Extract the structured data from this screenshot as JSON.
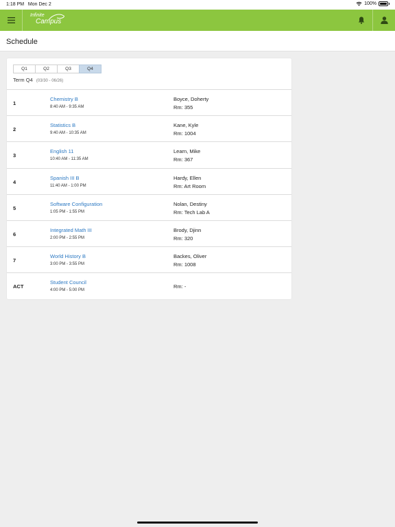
{
  "status_bar": {
    "time": "1:18 PM",
    "date": "Mon Dec 2",
    "battery": "100%",
    "icons": [
      "wifi-icon",
      "battery-icon"
    ]
  },
  "header": {
    "logo_top": "Infinite",
    "logo_bottom": "Campus",
    "brand_color": "#8cc63f",
    "icons": [
      "hamburger-menu-icon",
      "bell-icon",
      "user-icon"
    ]
  },
  "page": {
    "title": "Schedule"
  },
  "schedule": {
    "tabs": [
      "Q1",
      "Q2",
      "Q3",
      "Q4"
    ],
    "active_tab": "Q4",
    "term_label": "Term Q4",
    "term_dates": "(03/30 - 06/26)",
    "rows": [
      {
        "period": "1",
        "course": "Chemistry B",
        "time": "8:40 AM - 9:35 AM",
        "teacher": "Boyce, Doherty",
        "room": "Rm: 355"
      },
      {
        "period": "2",
        "course": "Statistics B",
        "time": "9:40 AM - 10:35 AM",
        "teacher": "Kane, Kyle",
        "room": "Rm: 1004"
      },
      {
        "period": "3",
        "course": "English 11",
        "time": "10:40 AM - 11:35 AM",
        "teacher": "Learn, Mike",
        "room": "Rm: 367"
      },
      {
        "period": "4",
        "course": "Spanish III B",
        "time": "11:40 AM - 1:00 PM",
        "teacher": "Hardy, Ellen",
        "room": "Rm: Art Room"
      },
      {
        "period": "5",
        "course": "Software Configuration",
        "time": "1:05 PM - 1:55 PM",
        "teacher": "Nolan, Destiny",
        "room": "Rm: Tech Lab A"
      },
      {
        "period": "6",
        "course": "Integrated Math III",
        "time": "2:00 PM - 2:55 PM",
        "teacher": "Brody, Djinn",
        "room": "Rm: 320"
      },
      {
        "period": "7",
        "course": "World History B",
        "time": "3:00 PM - 3:55 PM",
        "teacher": "Backes, Oliver",
        "room": "Rm: 1008"
      },
      {
        "period": "ACT",
        "course": "Student Council",
        "time": "4:00 PM - 5:00 PM",
        "teacher": "",
        "room": "Rm: -"
      }
    ]
  }
}
